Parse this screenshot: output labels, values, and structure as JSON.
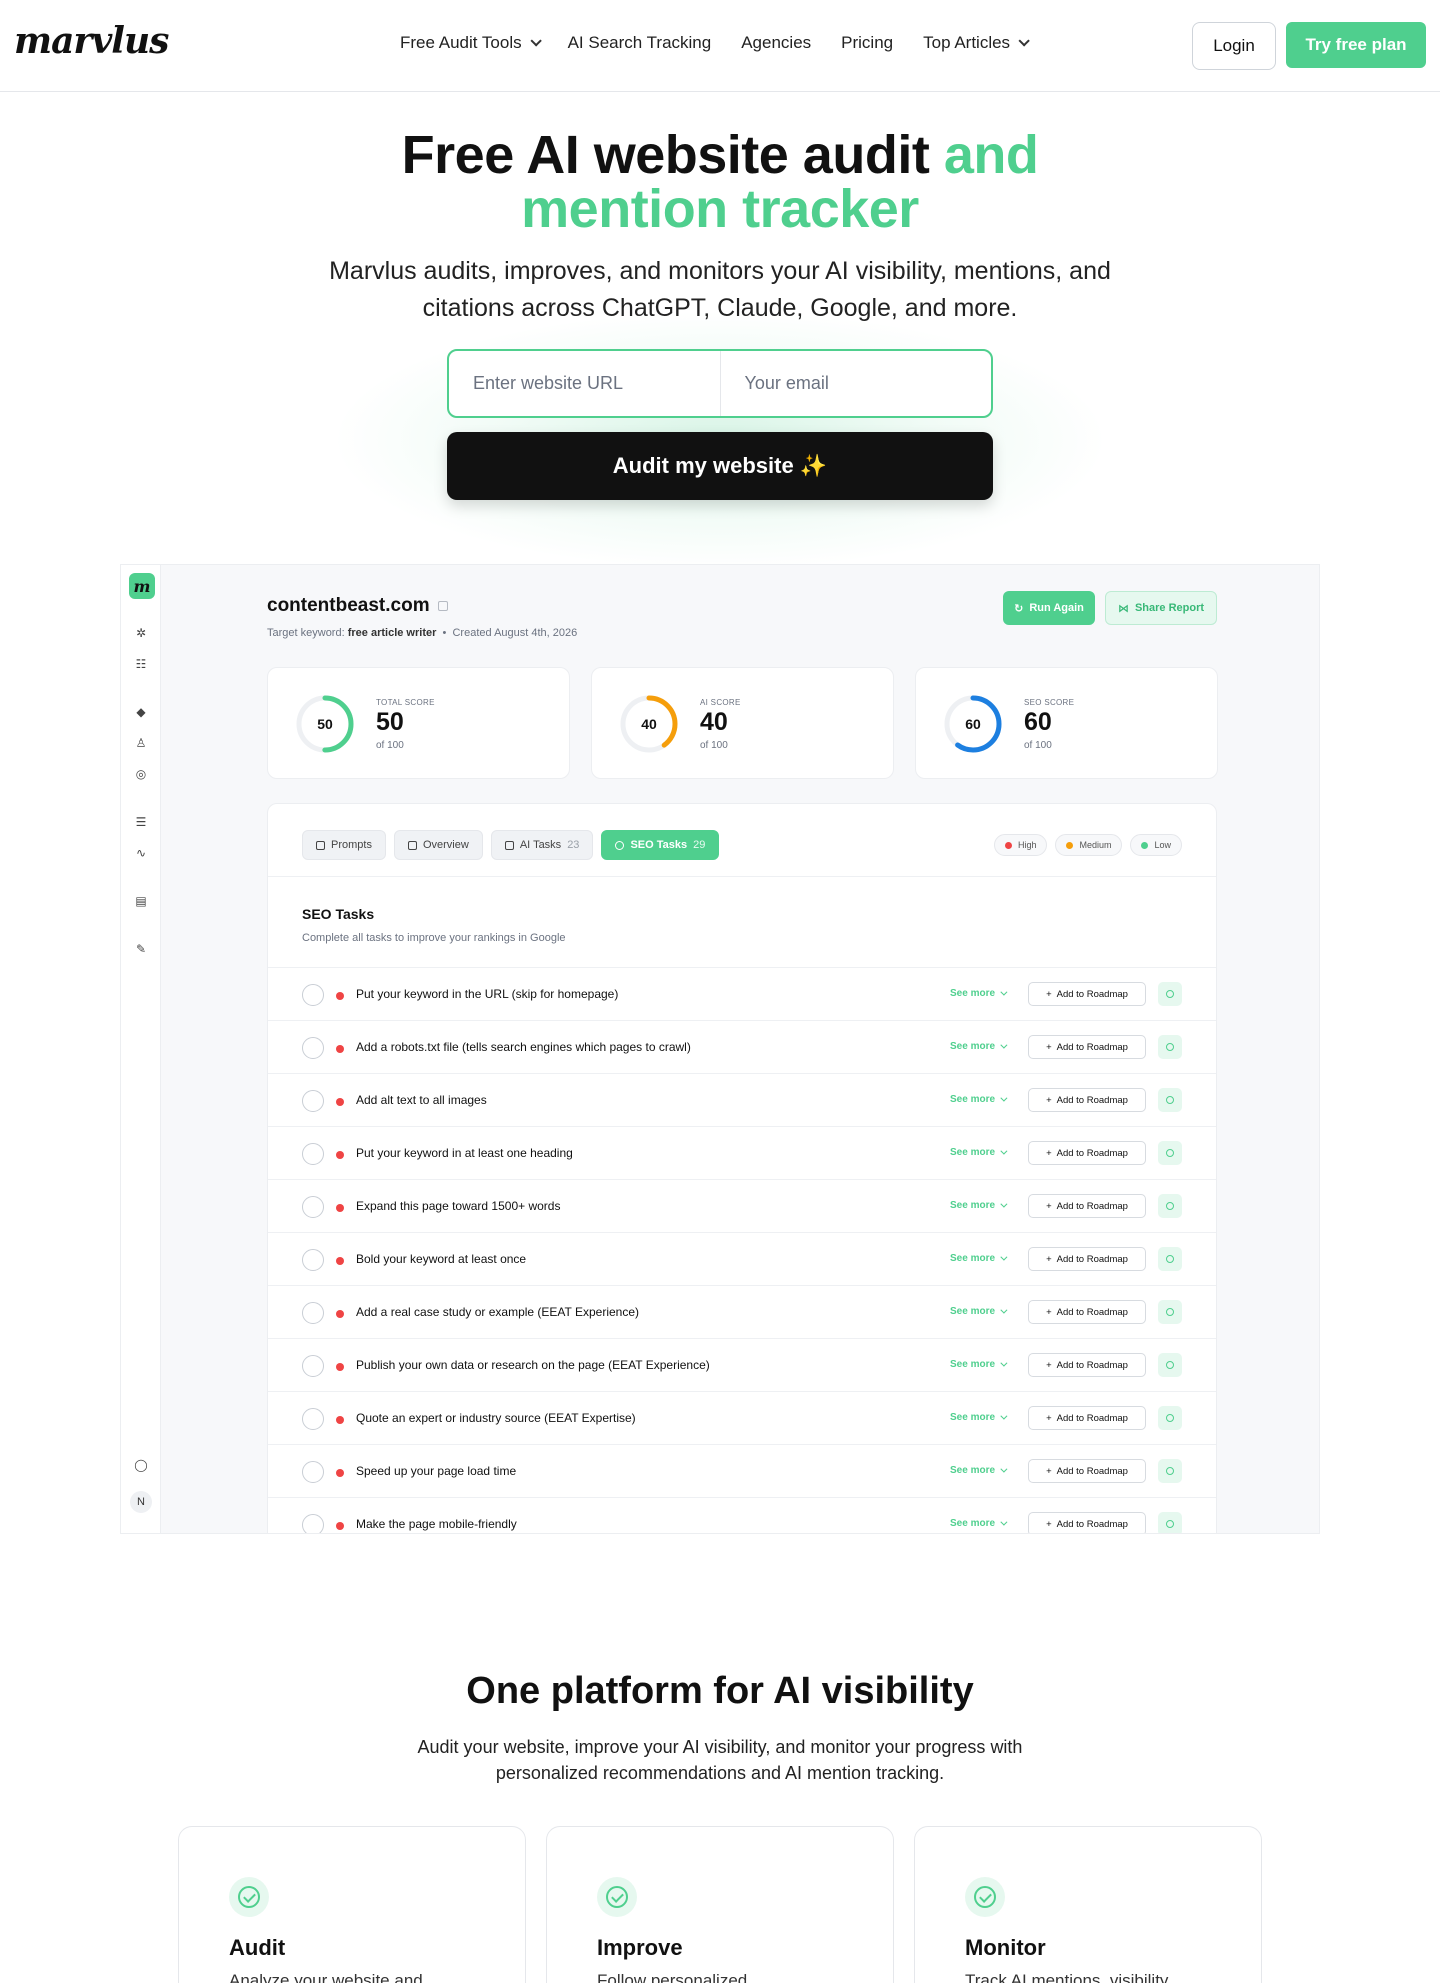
{
  "header": {
    "logo": "marvlus",
    "nav": [
      {
        "label": "Free Audit Tools",
        "has_dropdown": true
      },
      {
        "label": "AI Search Tracking",
        "has_dropdown": false
      },
      {
        "label": "Agencies",
        "has_dropdown": false
      },
      {
        "label": "Pricing",
        "has_dropdown": false
      },
      {
        "label": "Top Articles",
        "has_dropdown": true
      }
    ],
    "login_label": "Login",
    "try_label": "Try free plan"
  },
  "hero": {
    "title_black": "Free AI website audit ",
    "title_green_1": "and",
    "title_green_2": "mention tracker",
    "subtitle": "Marvlus audits, improves, and monitors your AI visibility, mentions, and citations across ChatGPT, Claude, Google, and more.",
    "url_placeholder": "Enter website URL",
    "email_placeholder": "Your email",
    "audit_button": "Audit my website ✨"
  },
  "app": {
    "logo_letter": "m",
    "avatar_letter": "N",
    "site": "contentbeast.com",
    "meta_keyword_label": "Target keyword:",
    "meta_keyword": "free article writer",
    "meta_separator": "•",
    "meta_created": "Created August 4th, 2026",
    "run_again": "Run Again",
    "share_report": "Share Report",
    "scores": [
      {
        "label": "TOTAL SCORE",
        "value": "50",
        "of": "of 100",
        "fraction": 0.5,
        "color": "#4fcf8e"
      },
      {
        "label": "AI SCORE",
        "value": "40",
        "of": "of 100",
        "fraction": 0.4,
        "color": "#f59e0b"
      },
      {
        "label": "SEO SCORE",
        "value": "60",
        "of": "of 100",
        "fraction": 0.6,
        "color": "#1d7fe0"
      }
    ],
    "tabs": [
      {
        "label": "Prompts",
        "count": ""
      },
      {
        "label": "Overview",
        "count": ""
      },
      {
        "label": "AI Tasks",
        "count": "23"
      },
      {
        "label": "SEO Tasks",
        "count": "29",
        "active": true
      }
    ],
    "priorities": [
      {
        "label": "High",
        "color": "#ef4444"
      },
      {
        "label": "Medium",
        "color": "#f59e0b"
      },
      {
        "label": "Low",
        "color": "#4fcf8e"
      }
    ],
    "section_title": "SEO Tasks",
    "section_subtitle": "Complete all tasks to improve your rankings in Google",
    "see_more": "See more",
    "add_roadmap": "Add to Roadmap",
    "tasks": [
      "Put your keyword in the URL (skip for homepage)",
      "Add a robots.txt file (tells search engines which pages to crawl)",
      "Add alt text to all images",
      "Put your keyword in at least one heading",
      "Expand this page toward 1500+ words",
      "Bold your keyword at least once",
      "Add a real case study or example (EEAT Experience)",
      "Publish your own data or research on the page (EEAT Experience)",
      "Quote an expert or industry source (EEAT Expertise)",
      "Speed up your page load time",
      "Make the page mobile-friendly"
    ]
  },
  "platform": {
    "title": "One platform for AI visibility",
    "subtitle": "Audit your website, improve your AI visibility, and monitor your progress with personalized recommendations and AI mention tracking.",
    "features": [
      {
        "title": "Audit",
        "desc": "Analyze your website and"
      },
      {
        "title": "Improve",
        "desc": "Follow personalized"
      },
      {
        "title": "Monitor",
        "desc": "Track AI mentions, visibility"
      }
    ]
  },
  "colors": {
    "brand_green": "#4fcf8e",
    "dark": "#111111",
    "high": "#ef4444",
    "medium": "#f59e0b",
    "seo_blue": "#1d7fe0"
  }
}
